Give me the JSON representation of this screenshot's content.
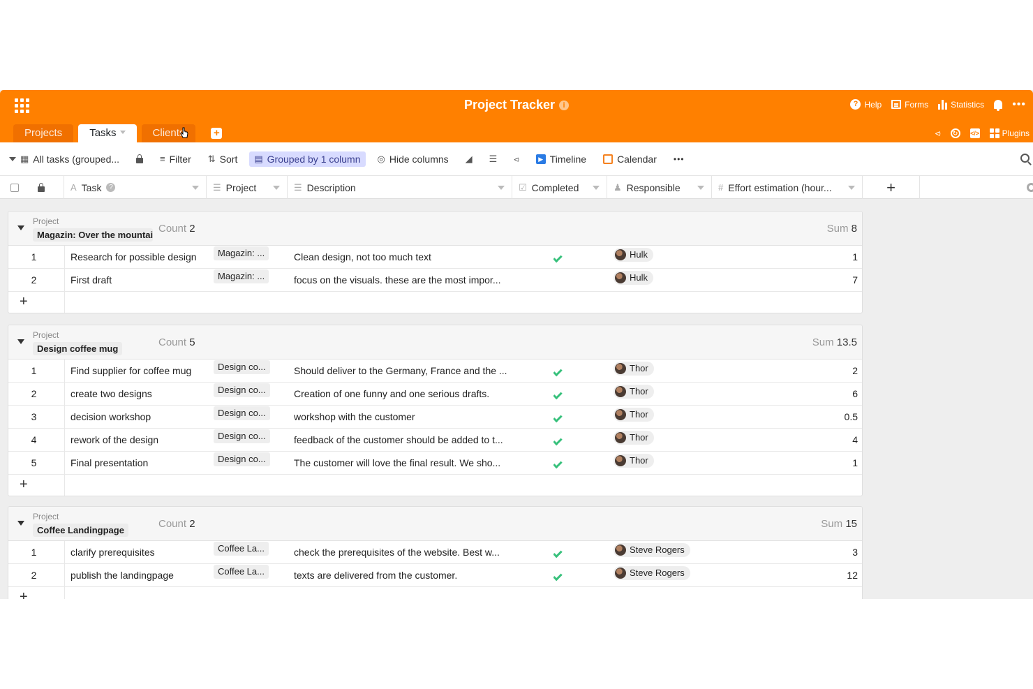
{
  "header": {
    "title": "Project Tracker",
    "help": "Help",
    "forms": "Forms",
    "statistics": "Statistics",
    "plugins": "Plugins"
  },
  "tabs": [
    "Projects",
    "Tasks",
    "Clients"
  ],
  "toolbar": {
    "view": "All tasks (grouped...",
    "filter": "Filter",
    "sort": "Sort",
    "grouped": "Grouped by 1 column",
    "hide_columns": "Hide columns",
    "timeline": "Timeline",
    "calendar": "Calendar"
  },
  "columns": {
    "task": "Task",
    "project": "Project",
    "description": "Description",
    "completed": "Completed",
    "responsible": "Responsible",
    "effort": "Effort estimation (hour..."
  },
  "groups": [
    {
      "label": "Project",
      "value": "Magazin: Over the mountain",
      "count_label": "Count",
      "count": "2",
      "sum_label": "Sum",
      "sum": "8",
      "rows": [
        {
          "num": "1",
          "task": "Research for possible design",
          "project": "Magazin: ...",
          "description": "Clean design, not too much text",
          "responsible": "Hulk",
          "effort": "1"
        },
        {
          "num": "2",
          "task": "First draft",
          "project": "Magazin: ...",
          "description": "focus on the visuals. these are the most impor...",
          "responsible": "Hulk",
          "effort": "7"
        }
      ]
    },
    {
      "label": "Project",
      "value": "Design coffee mug",
      "count_label": "Count",
      "count": "5",
      "sum_label": "Sum",
      "sum": "13.5",
      "rows": [
        {
          "num": "1",
          "task": "Find supplier for coffee mug",
          "project": "Design co...",
          "description": "Should deliver to the Germany, France and the ...",
          "responsible": "Thor",
          "effort": "2"
        },
        {
          "num": "2",
          "task": "create two designs",
          "project": "Design co...",
          "description": "Creation of one funny and one serious drafts.",
          "responsible": "Thor",
          "effort": "6"
        },
        {
          "num": "3",
          "task": "decision workshop",
          "project": "Design co...",
          "description": "workshop with the customer",
          "responsible": "Thor",
          "effort": "0.5"
        },
        {
          "num": "4",
          "task": "rework of the design",
          "project": "Design co...",
          "description": "feedback of the customer should be added to t...",
          "responsible": "Thor",
          "effort": "4"
        },
        {
          "num": "5",
          "task": "Final presentation",
          "project": "Design co...",
          "description": "The customer will love the final result. We sho...",
          "responsible": "Thor",
          "effort": "1"
        }
      ]
    },
    {
      "label": "Project",
      "value": "Coffee Landingpage",
      "count_label": "Count",
      "count": "2",
      "sum_label": "Sum",
      "sum": "15",
      "rows": [
        {
          "num": "1",
          "task": "clarify prerequisites",
          "project": "Coffee La...",
          "description": "check the prerequisites of the website. Best w...",
          "responsible": "Steve Rogers",
          "effort": "3"
        },
        {
          "num": "2",
          "task": "publish the landingpage",
          "project": "Coffee La...",
          "description": "texts are delivered from the customer.",
          "responsible": "Steve Rogers",
          "effort": "12"
        }
      ]
    }
  ]
}
